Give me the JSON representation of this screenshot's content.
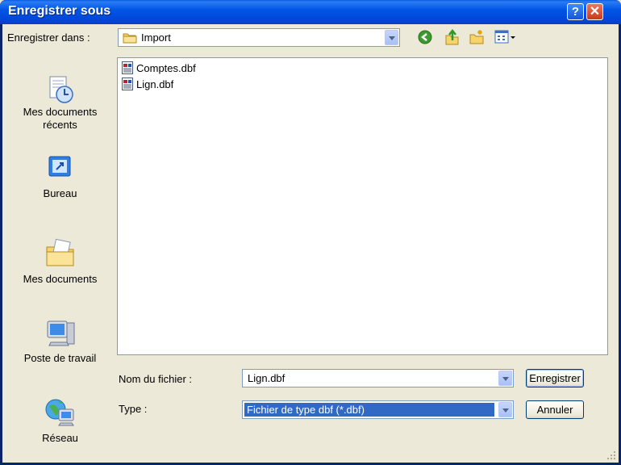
{
  "window": {
    "title": "Enregistrer sous"
  },
  "toolbar": {
    "save_in_label": "Enregistrer dans :",
    "current_folder": "Import"
  },
  "places": [
    {
      "label": "Mes documents\nrécents",
      "line1": "Mes documents",
      "line2": "récents",
      "icon": "recent-documents-icon"
    },
    {
      "label": "Bureau",
      "icon": "desktop-icon"
    },
    {
      "label": "Mes documents",
      "icon": "my-documents-icon"
    },
    {
      "label": "Poste de travail",
      "icon": "my-computer-icon"
    },
    {
      "label": "Réseau",
      "icon": "network-icon"
    }
  ],
  "files": [
    {
      "name": "Comptes.dbf",
      "icon": "dbf-file-icon"
    },
    {
      "name": "Lign.dbf",
      "icon": "dbf-file-icon"
    }
  ],
  "form": {
    "filename_label": "Nom du fichier :",
    "filename_value": "Lign.dbf",
    "type_label": "Type :",
    "type_value": "Fichier de type dbf (*.dbf)"
  },
  "buttons": {
    "save": "Enregistrer",
    "cancel": "Annuler"
  },
  "colors": {
    "titlebar": "#0054e3",
    "selection": "#316ac5",
    "dialog_bg": "#ece9d8"
  }
}
